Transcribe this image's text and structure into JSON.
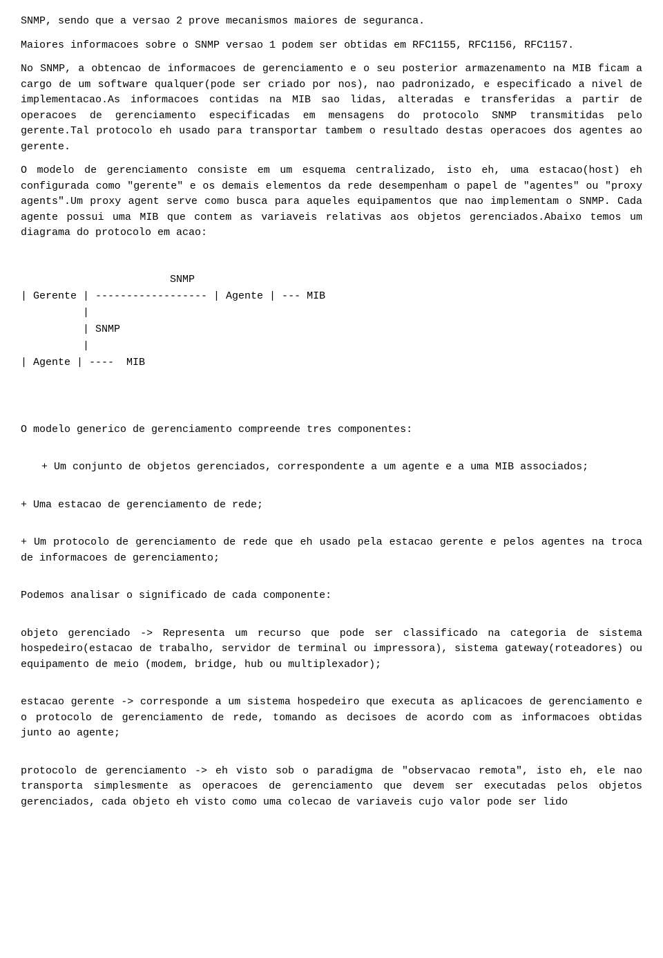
{
  "paragraphs": [
    {
      "id": "p1",
      "text": "SNMP, sendo que a versao 2 prove mecanismos maiores de seguranca."
    },
    {
      "id": "p2",
      "text": "Maiores informacoes sobre o SNMP versao 1 podem ser obtidas em RFC1155, RFC1156, RFC1157."
    },
    {
      "id": "p3",
      "text": "No SNMP, a obtencao de informacoes de gerenciamento e o seu posterior armazenamento na MIB ficam a cargo de um software qualquer(pode ser criado por nos), nao padronizado, e especificado a nivel de implementacao.As informacoes contidas na MIB sao lidas, alteradas e transferidas a partir de operacoes de gerenciamento especificadas em mensagens do protocolo SNMP transmitidas pelo gerente.Tal protocolo eh usado para transportar tambem o resultado destas operacoes dos agentes ao gerente."
    },
    {
      "id": "p4",
      "text": "O modelo de gerenciamento consiste em um esquema centralizado, isto eh, uma estacao(host) eh configurada como \"gerente\" e os demais elementos da rede desempenham o papel de \"agentes\" ou \"proxy agents\".Um proxy agent serve como busca para aqueles equipamentos que nao implementam o SNMP. Cada agente possui uma MIB que contem as variaveis relativas aos objetos gerenciados.Abaixo temos um diagrama do protocolo em acao:"
    },
    {
      "id": "p5",
      "text": "O modelo generico de gerenciamento compreende tres componentes:"
    },
    {
      "id": "p6",
      "text": "+ Um conjunto de objetos gerenciados, correspondente a um agente e a uma MIB associados;"
    },
    {
      "id": "p7",
      "text": "+ Uma estacao de gerenciamento de rede;"
    },
    {
      "id": "p8",
      "text": "+ Um protocolo de gerenciamento de rede que eh usado pela estacao gerente e pelos agentes na troca de informacoes de gerenciamento;"
    },
    {
      "id": "p9",
      "text": "Podemos analisar o significado de cada componente:"
    },
    {
      "id": "p10",
      "text": "objeto gerenciado -> Representa um recurso que pode ser classificado na categoria de sistema hospedeiro(estacao de trabalho, servidor de terminal ou impressora), sistema gateway(roteadores) ou equipamento de meio (modem, bridge, hub ou multiplexador);"
    },
    {
      "id": "p11",
      "text": "estacao gerente -> corresponde a um sistema hospedeiro que executa as aplicacoes de gerenciamento e o protocolo de gerenciamento de rede, tomando as decisoes de acordo com as informacoes obtidas junto ao agente;"
    },
    {
      "id": "p12",
      "text": "protocolo de gerenciamento -> eh visto sob o paradigma de \"observacao remota\", isto eh, ele nao transporta simplesmente as operacoes de gerenciamento que devem ser executadas pelos objetos gerenciados, cada objeto eh visto como uma colecao de variaveis cujo valor pode ser lido"
    }
  ],
  "diagram": {
    "line1": "                    SNMP",
    "line2": "| Gerente | ------------------ | Agente | --- MIB",
    "line3": "          |",
    "line4": "          | SNMP",
    "line5": "          |",
    "line6": "| Agente | ----  MIB"
  }
}
